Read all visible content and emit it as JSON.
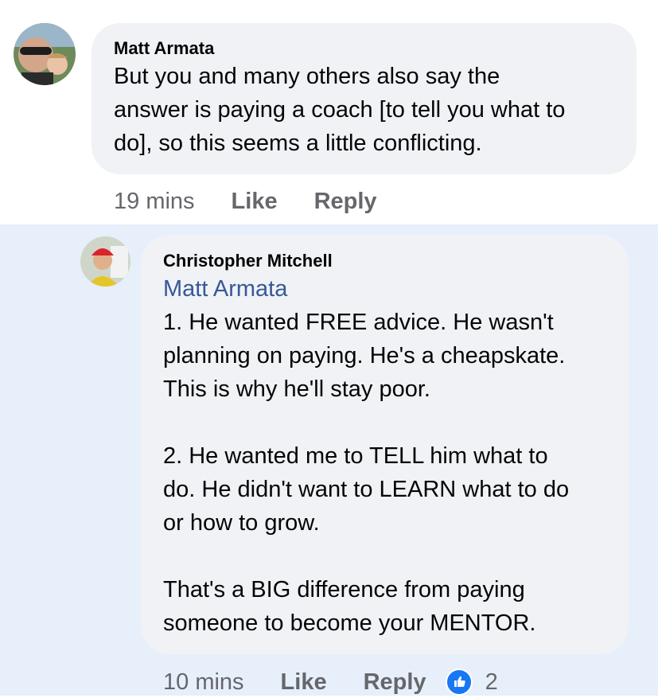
{
  "comments": [
    {
      "author": "Matt Armata",
      "text": "But you and many others also say the\nanswer is paying a coach [to tell you what to\ndo], so this seems a little conflicting.",
      "time": "19 mins",
      "like_label": "Like",
      "reply_label": "Reply"
    }
  ],
  "reply": {
    "author": "Christopher Mitchell",
    "mention": "Matt Armata",
    "text": "1. He wanted FREE advice. He wasn't\nplanning on paying. He's a cheapskate.\nThis is why he'll stay poor.\n\n2. He wanted me to TELL him what to\ndo. He didn't want to LEARN what to do\nor how to grow.\n\nThat's a BIG difference from paying\nsomeone to become your MENTOR.",
    "time": "10 mins",
    "like_label": "Like",
    "reply_label": "Reply",
    "reaction_icon": "thumbs-up-icon",
    "reaction_count": "2"
  },
  "colors": {
    "highlight_background": "#e7effb",
    "bubble": "#f0f2f5",
    "mention": "#385898",
    "like_reaction": "#1877f2",
    "meta_text": "#65676b"
  }
}
